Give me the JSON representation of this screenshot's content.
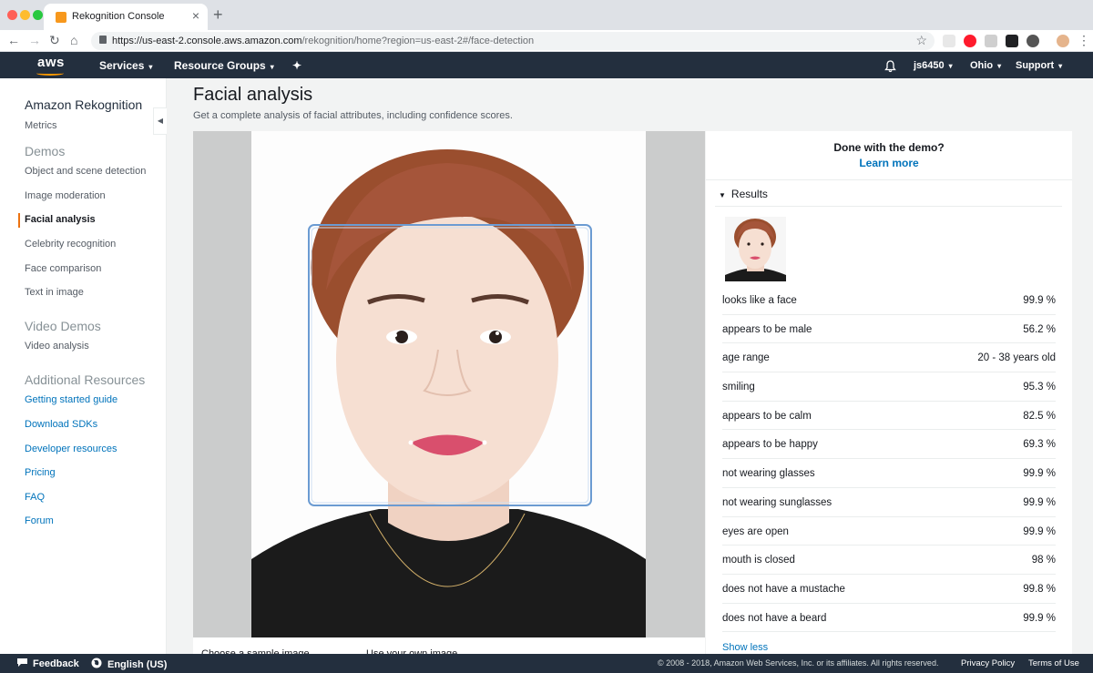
{
  "browser": {
    "tab_title": "Rekognition Console",
    "tab_close": "×",
    "new_tab": "+",
    "url_host": "https://us-east-2.console.aws.amazon.com",
    "url_path": "/rekognition/home?region=us-east-2#/face-detection",
    "back": "←",
    "forward": "→",
    "reload": "↻",
    "home": "⌂",
    "star": "☆",
    "menu": "⋮",
    "traffic_colors": [
      "#ff5f57",
      "#febc2e",
      "#28c840"
    ]
  },
  "awsnav": {
    "logo": "aws",
    "services": "Services",
    "resource_groups": "Resource Groups",
    "pin": "✦",
    "bell": "🔔",
    "user": "js6450",
    "region": "Ohio",
    "support": "Support",
    "caret": "▾"
  },
  "sidebar": {
    "title": "Amazon Rekognition",
    "metrics": "Metrics",
    "demos_head": "Demos",
    "demos": [
      "Object and scene detection",
      "Image moderation",
      "Facial analysis",
      "Celebrity recognition",
      "Face comparison",
      "Text in image"
    ],
    "video_head": "Video Demos",
    "video": [
      "Video analysis"
    ],
    "resources_head": "Additional Resources",
    "resources": [
      "Getting started guide",
      "Download SDKs",
      "Developer resources",
      "Pricing",
      "FAQ",
      "Forum"
    ],
    "collapse_icon": "◀"
  },
  "main": {
    "title": "Facial analysis",
    "subtitle": "Get a complete analysis of facial attributes, including confidence scores.",
    "choose_sample": "Choose a sample image",
    "use_own": "Use your own image"
  },
  "results": {
    "done": "Done with the demo?",
    "learn_more": "Learn more",
    "heading": "Results",
    "toggle_icon": "▼",
    "rows": [
      {
        "label": "looks like a face",
        "value": "99.9 %"
      },
      {
        "label": "appears to be male",
        "value": "56.2 %"
      },
      {
        "label": "age range",
        "value": "20 - 38 years old"
      },
      {
        "label": "smiling",
        "value": "95.3 %"
      },
      {
        "label": "appears to be calm",
        "value": "82.5 %"
      },
      {
        "label": "appears to be happy",
        "value": "69.3 %"
      },
      {
        "label": "not wearing glasses",
        "value": "99.9 %"
      },
      {
        "label": "not wearing sunglasses",
        "value": "99.9 %"
      },
      {
        "label": "eyes are open",
        "value": "99.9 %"
      },
      {
        "label": "mouth is closed",
        "value": "98 %"
      },
      {
        "label": "does not have a mustache",
        "value": "99.8 %"
      },
      {
        "label": "does not have a beard",
        "value": "99.9 %"
      }
    ],
    "show_less": "Show less"
  },
  "footer": {
    "feedback": "Feedback",
    "language": "English (US)",
    "copyright": "© 2008 - 2018, Amazon Web Services, Inc. or its affiliates. All rights reserved.",
    "privacy": "Privacy Policy",
    "terms": "Terms of Use"
  },
  "colors": {
    "aws_nav": "#232f3e",
    "accent_orange": "#ec7211",
    "link_blue": "#0073bb",
    "face_box": "#5b9bd5"
  }
}
